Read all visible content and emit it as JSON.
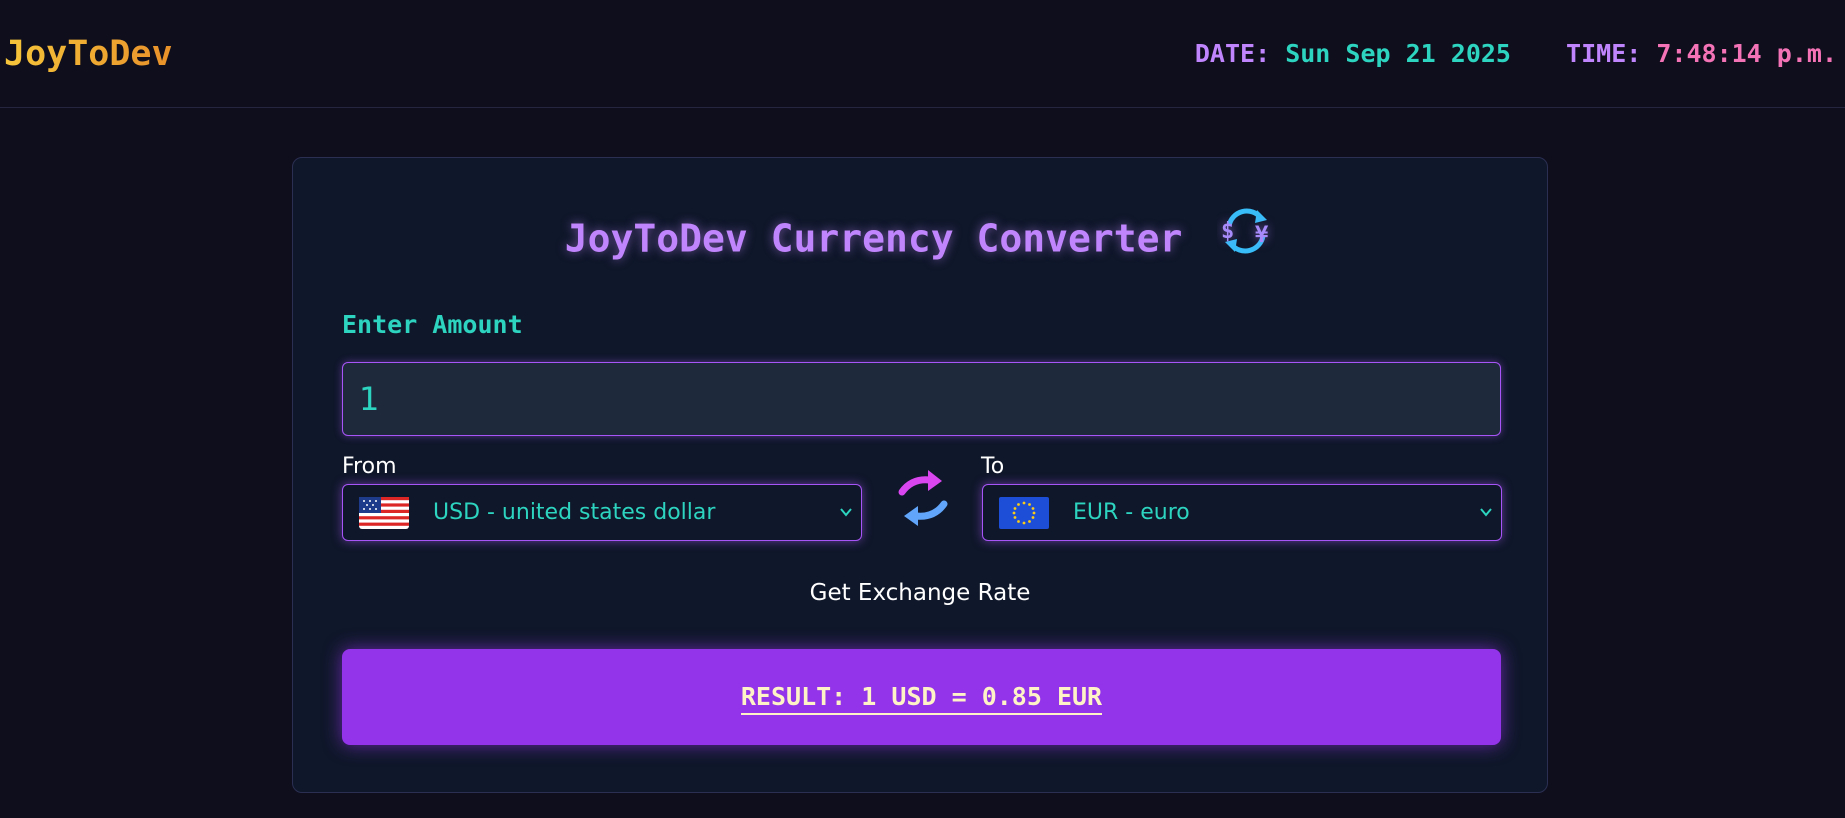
{
  "header": {
    "logo": "JoyToDev",
    "date_label": "DATE:",
    "date_value": "Sun Sep 21 2025",
    "time_label": "TIME:",
    "time_value": "7:48:14 p.m."
  },
  "converter": {
    "title": "JoyToDev Currency Converter",
    "title_icon": "currency-exchange-icon",
    "amount_label": "Enter Amount",
    "amount_value": "1",
    "from_label": "From",
    "from_currency": "USD - united states dollar",
    "from_flag": "us-flag-icon",
    "to_label": "To",
    "to_currency": "EUR - euro",
    "to_flag": "eu-flag-icon",
    "swap_icon": "swap-arrows-icon",
    "rate_button": "Get Exchange Rate",
    "result": "RESULT: 1 USD = 0.85 EUR"
  },
  "colors": {
    "background": "#0e0e1d",
    "card": "#0f172a",
    "accent_purple": "#a855f7",
    "result_button": "#9333ea",
    "teal": "#2dd4bf",
    "pink": "#f472b6",
    "logo_gold": "#f6c63a"
  }
}
